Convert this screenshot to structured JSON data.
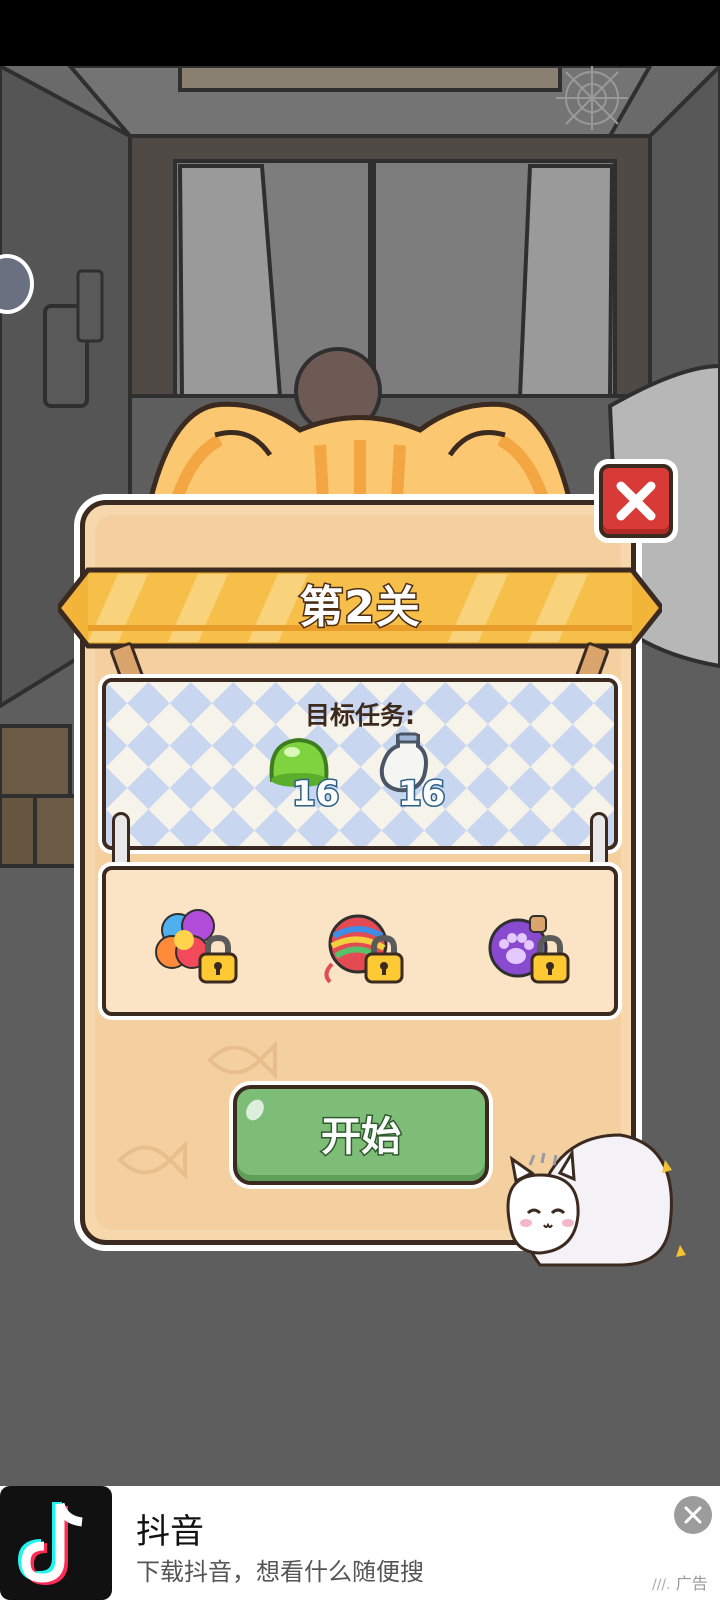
{
  "dialog": {
    "level_title": "第2关",
    "task_label": "目标任务:",
    "goals": [
      {
        "icon": "green-jelly-icon",
        "count": "16"
      },
      {
        "icon": "milk-bottle-icon",
        "count": "16"
      }
    ],
    "boosters": [
      {
        "icon": "rainbow-candy-booster-icon",
        "locked": true
      },
      {
        "icon": "yarn-ball-booster-icon",
        "locked": true
      },
      {
        "icon": "paw-potion-booster-icon",
        "locked": true
      }
    ],
    "start_label": "开始"
  },
  "ad": {
    "app_name": "抖音",
    "subtitle": "下载抖音，想看什么随便搜",
    "tag": "广告"
  },
  "colors": {
    "panel": "#f7d8ad",
    "ribbon": "#f2b53a",
    "start_button": "#7ebd78",
    "close_button": "#d83b37",
    "outline": "#3b2a20"
  }
}
